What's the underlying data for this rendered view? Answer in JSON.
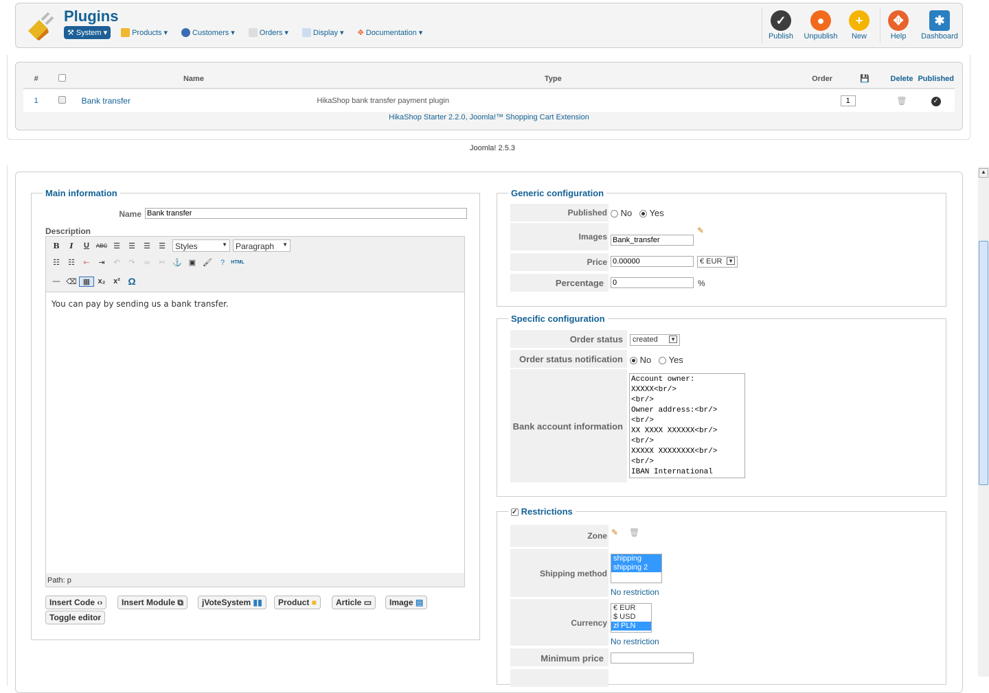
{
  "header": {
    "title": "Plugins",
    "menu": [
      {
        "label": "System",
        "selected": true
      },
      {
        "label": "Products"
      },
      {
        "label": "Customers"
      },
      {
        "label": "Orders"
      },
      {
        "label": "Display"
      },
      {
        "label": "Documentation"
      }
    ],
    "toolbar": [
      {
        "label": "Publish",
        "icon": "check-icon",
        "color": "#3d3d3d"
      },
      {
        "label": "Unpublish",
        "icon": "unpublish-icon",
        "color": "#f26b1d"
      },
      {
        "label": "New",
        "icon": "plus-icon",
        "color": "#f4b400"
      },
      {
        "label": "Help",
        "icon": "help-icon",
        "color": "#e8632b"
      },
      {
        "label": "Dashboard",
        "icon": "dashboard-icon",
        "color": "#2a7fc1"
      }
    ]
  },
  "table": {
    "headers": {
      "num": "#",
      "name": "Name",
      "type": "Type",
      "order": "Order",
      "delete": "Delete",
      "published": "Published"
    },
    "rows": [
      {
        "num": "1",
        "name": "Bank transfer",
        "type": "HikaShop bank transfer payment plugin",
        "order": "1"
      }
    ],
    "footer": "HikaShop Starter 2.2.0, Joomla!™ Shopping Cart Extension"
  },
  "version": "Joomla! 2.5.3",
  "main": {
    "legend": "Main information",
    "name_label": "Name",
    "name_value": "Bank transfer",
    "desc_label": "Description",
    "styles": "Styles",
    "paragraph": "Paragraph",
    "html_label": "HTML",
    "content": "You can pay by sending us a bank transfer.",
    "path": "Path: p",
    "buttons": [
      "Insert Code",
      "Insert Module",
      "jVoteSystem",
      "Product",
      "Article",
      "Image",
      "Toggle editor"
    ]
  },
  "generic": {
    "legend": "Generic configuration",
    "published_label": "Published",
    "no": "No",
    "yes": "Yes",
    "images_label": "Images",
    "images_value": "Bank_transfer",
    "price_label": "Price",
    "price_value": "0.00000",
    "currency": "€ EUR",
    "percentage_label": "Percentage",
    "percentage_value": "0",
    "percent_sign": "%"
  },
  "specific": {
    "legend": "Specific configuration",
    "order_status_label": "Order status",
    "order_status_value": "created",
    "notif_label": "Order status notification",
    "no": "No",
    "yes": "Yes",
    "bank_label": "Bank account information",
    "bank_value": "Account owner:\nXXXXX<br/>\n<br/>\nOwner address:<br/>\n<br/>\nXX XXXX XXXXXX<br/>\n<br/>\nXXXXX XXXXXXXX<br/>\n<br/>\nIBAN International"
  },
  "restrictions": {
    "legend": "Restrictions",
    "zone_label": "Zone",
    "shipping_label": "Shipping method",
    "shipping_options": [
      "shipping",
      "shipping 2"
    ],
    "no_restriction": "No restriction",
    "currency_label": "Currency",
    "currency_options": [
      "€ EUR",
      "$ USD",
      "zł PLN"
    ],
    "min_price_label": "Minimum price"
  }
}
